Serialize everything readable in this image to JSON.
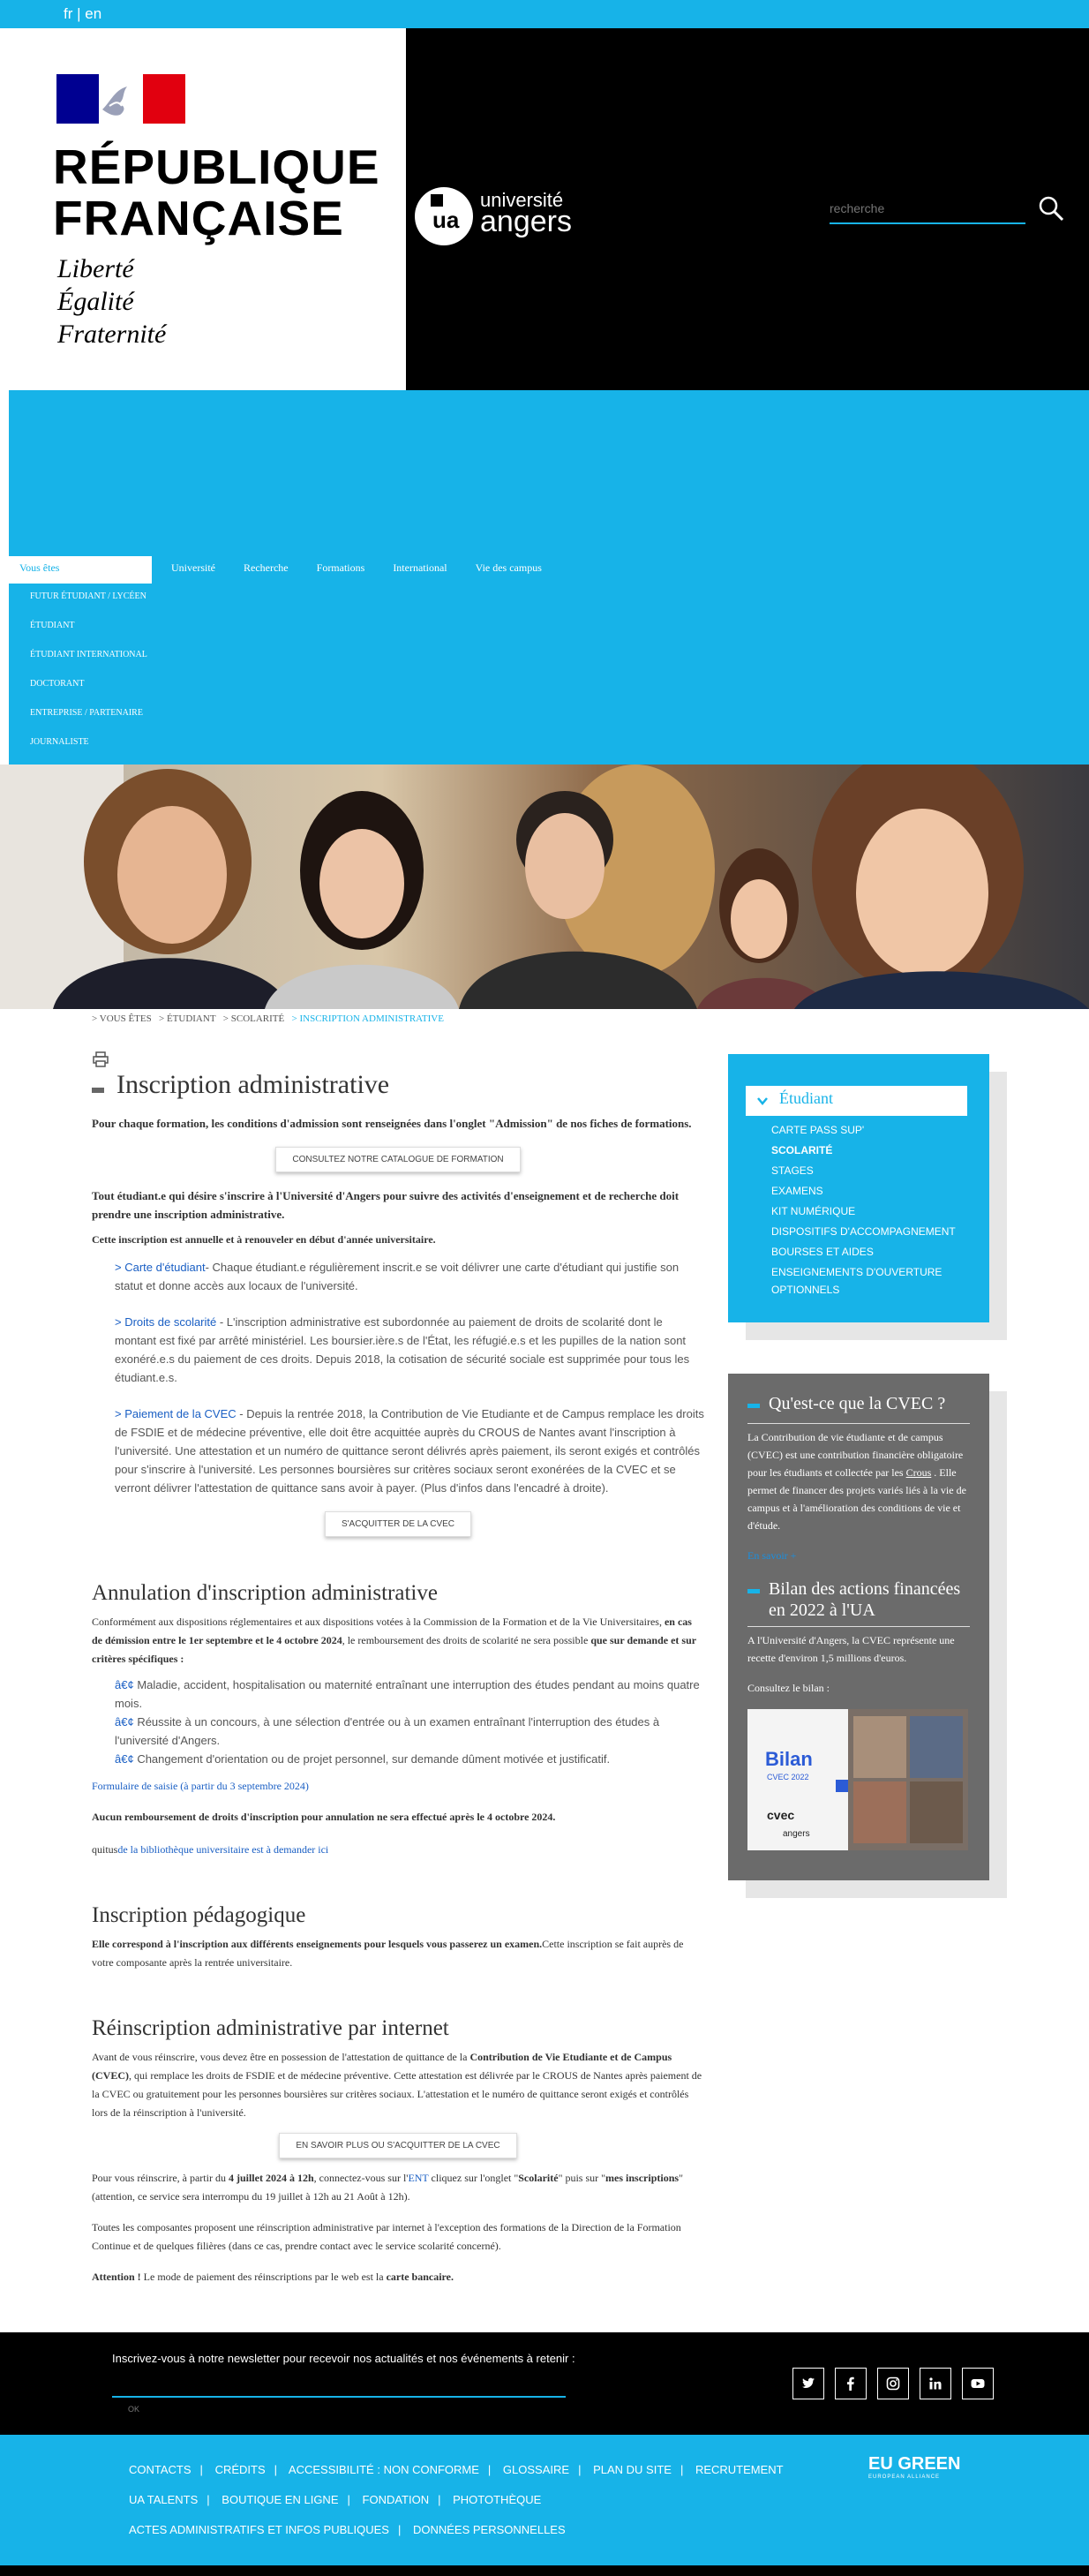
{
  "topbar": {
    "lang": "fr | en"
  },
  "header": {
    "rf_title_1": "RÉPUBLIQUE",
    "rf_title_2": "FRANÇAISE",
    "motto_1": "Liberté",
    "motto_2": "Égalité",
    "motto_3": "Fraternité",
    "logo_top": "université",
    "logo_bottom": "angers",
    "search_placeholder": "recherche"
  },
  "nav": {
    "active": "Vous êtes",
    "main": [
      "Université",
      "Recherche",
      "Formations",
      "International",
      "Vie des campus"
    ],
    "sub": [
      "FUTUR ÉTUDIANT / LYCÉEN",
      "ÉTUDIANT",
      "ÉTUDIANT INTERNATIONAL",
      "DOCTORANT",
      "ENTREPRISE / PARTENAIRE",
      "JOURNALISTE"
    ]
  },
  "breadcrumb": [
    "> VOUS ÊTES",
    "> ÉTUDIANT",
    "> SCOLARITÉ"
  ],
  "breadcrumb_current": "> INSCRIPTION ADMINISTRATIVE",
  "main": {
    "title": "Inscription administrative",
    "intro": "Pour chaque formation, les conditions d'admission sont renseignées dans l'onglet \"Admission\" de nos fiches de formations.",
    "btn_catalogue": "CONSULTEZ NOTRE CATALOGUE DE FORMATION",
    "p_all": "Tout étudiant.e qui désire s'inscrire à l'Université d'Angers pour suivre des activités d'enseignement et de recherche doit prendre une inscription administrative.",
    "p_annual": "Cette inscription est annuelle et à renouveler en début d'année universitaire.",
    "item1_link": "> Carte d'étudiant",
    "item1_text": "- Chaque étudiant.e régulièrement inscrit.e se voit délivrer une carte d'étudiant qui justifie son statut et donne accès aux locaux de l'université.",
    "item2_link": "> Droits de scolarité",
    "item2_text": " - L'inscription administrative est subordonnée au paiement de droits de scolarité dont le montant est fixé par arrêté ministériel. Les boursier.ière.s de l'État, les réfugié.e.s et les pupilles de la nation sont exonéré.e.s du paiement de ces droits. Depuis 2018, la cotisation de sécurité sociale est supprimée pour tous les étudiant.e.s.",
    "item3_link": "> Paiement de la CVEC",
    "item3_text": " - Depuis la rentrée 2018, la Contribution de Vie Etudiante et de Campus remplace les droits de FSDIE et de médecine préventive, elle doit être acquittée auprès du CROUS de Nantes avant l'inscription à l'université. Une attestation et un numéro de quittance seront délivrés après paiement, ils seront exigés et contrôlés pour s'inscrire à l'université. Les personnes boursières sur critères sociaux seront exonérées de la CVEC et se verront délivrer l'attestation de quittance sans avoir à payer. (Plus d'infos dans l'encadré à droite).",
    "btn_cvec": "S'ACQUITTER DE LA CVEC",
    "h_annulation": "Annulation d'inscription administrative",
    "annul_p1": "Conformément aux dispositions réglementaires et aux dispositions votées à la Commission de la Formation et de la Vie Universitaires, ",
    "annul_p1b": "en cas de démission entre le 1er septembre et le 4 octobre 2024",
    "annul_p1c": ", le remboursement des droits de scolarité ne sera possible ",
    "annul_p1d": "que sur demande et sur critères spécifiques :",
    "bul1": " Maladie, accident, hospitalisation ou maternité entraînant une interruption des études pendant au moins quatre mois.",
    "bul2": " Réussite à un concours, à une sélection d'entrée ou à un examen entraînant l'interruption des études à l'université d'Angers.",
    "bul3": " Changement d'orientation ou de projet personnel, sur demande dûment motivée et justificatif.",
    "bullet_glyph": "â€¢",
    "form_link": "Formulaire de saisie (à partir du 3 septembre 2024)",
    "no_refund": "Aucun remboursement de droits d'inscription pour annulation ne sera effectué après le 4 octobre 2024.",
    "quitus_a": "quitus",
    "quitus_b": "de la bibliothèque universitaire est à demander ici",
    "h_pedago": "Inscription pédagogique",
    "pedago_b": "Elle correspond à l'inscription aux différents enseignements pour lesquels vous passerez un examen.",
    "pedago_t": "Cette inscription se fait auprès de votre composante après la rentrée universitaire.",
    "h_reinscr": "Réinscription administrative par internet",
    "re_p1a": "Avant de vous réinscrire, vous devez être en possession de l'attestation de quittance de la ",
    "re_p1b": "Contribution de Vie Etudiante et de Campus (CVEC)",
    "re_p1c": ", qui remplace les droits de FSDIE et de médecine préventive. Cette attestation est délivrée par le CROUS de Nantes après paiement de la CVEC ou gratuitement pour les personnes boursières sur critères sociaux. L'attestation et le numéro de quittance seront exigés et contrôlés lors de la réinscription à l'université.",
    "btn_more": "EN SAVOIR PLUS OU S'ACQUITTER DE LA CVEC",
    "re_p2a": "Pour vous réinscrire, à partir du ",
    "re_p2b": "4 juillet 2024 à 12h",
    "re_p2c": ", connectez-vous sur l'",
    "re_p2d": "ENT",
    "re_p2e": " cliquez sur l'onglet \"",
    "re_p2f": "Scolarité",
    "re_p2g": "\" puis sur \"",
    "re_p2h": "mes inscriptions",
    "re_p2i": "\" (attention, ce service sera interrompu du 19 juillet à 12h au 21 Août à 12h).",
    "re_p3": "Toutes les composantes proposent une réinscription administrative par internet à l'exception des formations de la Direction de la Formation Continue et de quelques filières (dans ce cas, prendre contact avec le service scolarité concerné).",
    "re_p4a": "Attention !",
    "re_p4b": " Le mode de paiement des réinscriptions par le web est la ",
    "re_p4c": "carte bancaire."
  },
  "sidebar": {
    "head": "Étudiant",
    "items": [
      "CARTE PASS SUP'",
      "SCOLARITÉ",
      "STAGES",
      "EXAMENS",
      "KIT NUMÉRIQUE",
      "DISPOSITIFS D'ACCOMPAGNEMENT",
      "BOURSES ET AIDES",
      "ENSEIGNEMENTS D'OUVERTURE OPTIONNELS"
    ],
    "active_index": 1
  },
  "cvec": {
    "h1": "Qu'est-ce que la CVEC ?",
    "p1a": "La Contribution de vie étudiante et de campus (CVEC) est une contribution financière obligatoire pour les étudiants et collectée par les ",
    "p1b": "Crous",
    "p1c": " . Elle permet de financer des projets variés liés à la vie de campus et à l'amélioration des conditions de vie et d'étude.",
    "more": "En savoir +",
    "h2": "Bilan des actions financées en 2022 à l'UA",
    "p2": "A l'Université d'Angers, la CVEC représente une recette d'environ 1,5 millions d'euros.",
    "p3": "Consultez le bilan :",
    "img_title": "Bilan",
    "img_sub": "CVEC 2022",
    "img_logo": "cvec",
    "img_ua": "angers"
  },
  "footer": {
    "newsletter": "Inscrivez-vous à notre newsletter pour recevoir nos actualités et nos événements à retenir :",
    "ok": "OK",
    "socials": [
      "twitter-icon",
      "facebook-icon",
      "instagram-icon",
      "linkedin-icon",
      "youtube-icon"
    ],
    "row1": [
      "CONTACTS",
      "CRÉDITS",
      "ACCESSIBILITÉ : NON CONFORME",
      "GLOSSAIRE",
      "PLAN DU SITE",
      "RECRUTEMENT"
    ],
    "row2": [
      "UA TALENTS",
      "BOUTIQUE EN LIGNE",
      "FONDATION",
      "PHOTOTHÈQUE"
    ],
    "row3": [
      "ACTES ADMINISTRATIFS ET INFOS PUBLIQUES",
      "DONNÉES PERSONNELLES"
    ],
    "eu_green": "EU GREEN",
    "eu_sub": "EUROPEAN ALLIANCE"
  },
  "colors": {
    "accent": "#17b3e8",
    "dark": "#000000",
    "grey_box": "#6b6b6b",
    "link": "#1a5fc4"
  }
}
